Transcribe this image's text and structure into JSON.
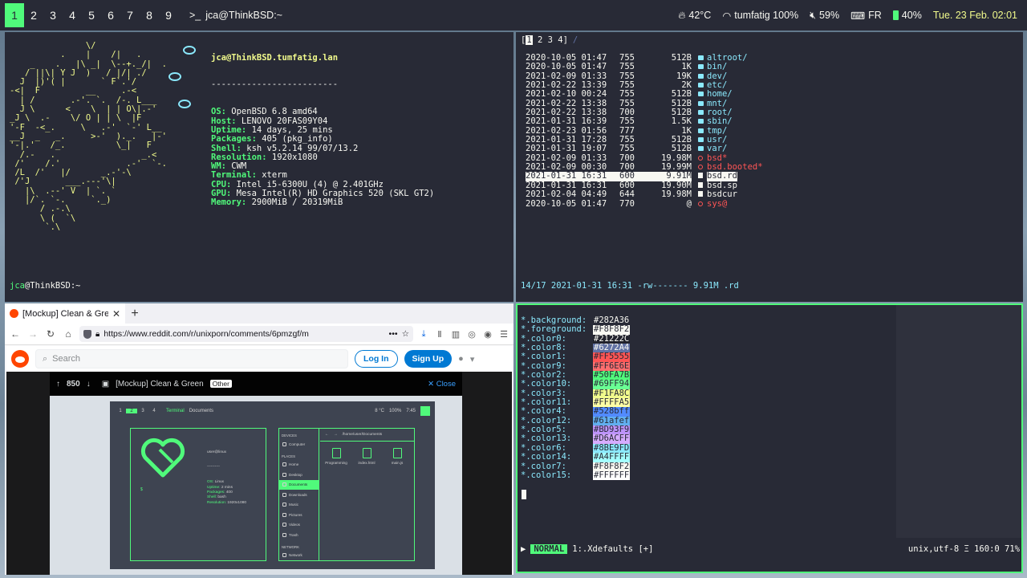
{
  "topbar": {
    "workspaces": [
      "1",
      "2",
      "3",
      "4",
      "5",
      "6",
      "7",
      "8",
      "9"
    ],
    "active_workspace": "1",
    "window_title": "jca@ThinkBSD:~",
    "temp": "42°C",
    "wifi": "tumfatig 100%",
    "volume": "59%",
    "keyboard": "FR",
    "battery": "40%",
    "datetime": "Tue. 23 Feb. 02:01"
  },
  "neofetch": {
    "ascii": [
      "               \\/",
      "          .    |    /|   .",
      "    _    .   |\\ _|  \\--+._/|  .",
      "   / ||\\| Y J  )   / |/| ./",
      "  J  |)'( |       ` F`.'/ ",
      "-<|  F         __     .-<",
      "  | /       .-'. `.  /-. L___",
      "  J \\      <    \\  | | O\\|.-'",
      "_J \\  .-    \\/ O | | \\  |F",
      "'-F  -<_.     \\   .-'  `-' L__",
      "__J  _   _.     >-'  )._.   |-'",
      "'-|.'   /_.          \\_|   F",
      "  /.-   .                 _.<",
      " /'    /.'             .-'  `-.",
      " /L  /'   |/      _.-'-\\",
      " /'J       ___.---'\\|",
      "   |\\  .--' V  | `. `",
      "   |/`. `-.     `._)",
      "      / .-.\\",
      "      \\ (  `\\",
      "       `.\\"
    ],
    "header_user": "jca",
    "header_host": "@ThinkBSD.tumfatig.lan",
    "separator": "-------------------------",
    "rows": [
      {
        "k": "OS:",
        "v": " OpenBSD 6.8 amd64"
      },
      {
        "k": "Host:",
        "v": " LENOVO 20FAS09Y04"
      },
      {
        "k": "Uptime:",
        "v": " 14 days, 25 mins"
      },
      {
        "k": "Packages:",
        "v": " 405 (pkg_info)"
      },
      {
        "k": "Shell:",
        "v": " ksh v5.2.14 99/07/13.2"
      },
      {
        "k": "Resolution:",
        "v": " 1920x1080"
      },
      {
        "k": "WM:",
        "v": " CWM"
      },
      {
        "k": "Terminal:",
        "v": " xterm"
      },
      {
        "k": "CPU:",
        "v": " Intel i5-6300U (4) @ 2.401GHz"
      },
      {
        "k": "GPU:",
        "v": " Mesa Intel(R) HD Graphics 520 (SKL GT2)"
      },
      {
        "k": "Memory:",
        "v": " 2900MiB / 20319MiB"
      }
    ],
    "prompt_user": "jca",
    "prompt_host": "@ThinkBSD:~",
    "prompt_sign": "# "
  },
  "lf": {
    "tab_active": "1",
    "tabs_rest": " 2 3 4]",
    "tab_open": "[",
    "path": "/",
    "rows": [
      {
        "d": "2020-10-05 01:47",
        "p": "755",
        "s": "512B",
        "n": "altroot/",
        "t": "dir"
      },
      {
        "d": "2020-10-05 01:47",
        "p": "755",
        "s": "1K",
        "n": "bin/",
        "t": "dir"
      },
      {
        "d": "2021-02-09 01:33",
        "p": "755",
        "s": "19K",
        "n": "dev/",
        "t": "dir"
      },
      {
        "d": "2021-02-22 13:39",
        "p": "755",
        "s": "2K",
        "n": "etc/",
        "t": "dir"
      },
      {
        "d": "2021-02-10 00:24",
        "p": "755",
        "s": "512B",
        "n": "home/",
        "t": "dir"
      },
      {
        "d": "2021-02-22 13:38",
        "p": "755",
        "s": "512B",
        "n": "mnt/",
        "t": "dir"
      },
      {
        "d": "2021-02-22 13:38",
        "p": "700",
        "s": "512B",
        "n": "root/",
        "t": "dir"
      },
      {
        "d": "2021-01-31 16:39",
        "p": "755",
        "s": "1.5K",
        "n": "sbin/",
        "t": "dir"
      },
      {
        "d": "2021-02-23 01:56",
        "p": "777",
        "s": "1K",
        "n": "tmp/",
        "t": "dir"
      },
      {
        "d": "2021-01-31 17:28",
        "p": "755",
        "s": "512B",
        "n": "usr/",
        "t": "dir"
      },
      {
        "d": "2021-01-31 19:07",
        "p": "755",
        "s": "512B",
        "n": "var/",
        "t": "dir"
      },
      {
        "d": "2021-02-09 01:33",
        "p": "700",
        "s": "19.98M",
        "n": "bsd*",
        "t": "warn"
      },
      {
        "d": "2021-02-09 00:30",
        "p": "700",
        "s": "19.99M",
        "n": "bsd.booted*",
        "t": "warn"
      },
      {
        "d": "2021-01-31 16:31",
        "p": "600",
        "s": "9.91M",
        "n": "bsd.rd",
        "t": "sel"
      },
      {
        "d": "2021-01-31 16:31",
        "p": "600",
        "s": "19.90M",
        "n": "bsd.sp",
        "t": "file"
      },
      {
        "d": "2021-02-04 04:49",
        "p": "644",
        "s": "19.98M",
        "n": "bsdcur",
        "t": "file"
      },
      {
        "d": "2020-10-05 01:47",
        "p": "770",
        "s": "@",
        "n": "sys@",
        "t": "warn"
      }
    ],
    "status": "14/17 2021-01-31 16:31 -rw------- 9.91M .rd"
  },
  "browser": {
    "tab_title": "[Mockup] Clean & Green",
    "url": "https://www.reddit.com/r/unixporn/comments/6pmzgf/m",
    "search_placeholder": "Search",
    "login": "Log In",
    "signup": "Sign Up",
    "post": {
      "score": "850",
      "title": "[Mockup] Clean & Green",
      "flair": "Other",
      "close": "Close"
    },
    "mockup": {
      "workspaces": [
        "1",
        "2",
        "3",
        "4"
      ],
      "active": "2",
      "term_label": "Terminal",
      "docs_label": "Documents",
      "status_temp": "8 °C",
      "status_batt": "100%",
      "status_time": "7:45",
      "info_title": "user@linux",
      "info_sep": "----------",
      "info_rows": [
        {
          "k": "OS:",
          "v": " Linux"
        },
        {
          "k": "Uptime:",
          "v": " 2 mins"
        },
        {
          "k": "Packages:",
          "v": " 400"
        },
        {
          "k": "Shell:",
          "v": " bash"
        },
        {
          "k": "Resolution:",
          "v": " 1920x1080"
        }
      ],
      "prompt": "$ ",
      "devices_header": "DEVICES",
      "devices": [
        "Computer"
      ],
      "places_header": "PLACES",
      "places": [
        "Home",
        "Desktop",
        "Documents",
        "Downloads",
        "Music",
        "Pictures",
        "Videos",
        "Trash"
      ],
      "places_selected": "Documents",
      "network_header": "NETWORK",
      "network": [
        "Network"
      ],
      "path": "/home/user/Documents",
      "files": [
        "Programming",
        "index.html",
        "main.js"
      ]
    }
  },
  "vim": {
    "lines": [
      {
        "k": "*.background:",
        "v": "#282A36",
        "bg": "#282a36",
        "fg": "#f8f8f2"
      },
      {
        "k": "*.foreground:",
        "v": "#F8F8F2",
        "bg": "#f8f8f2",
        "fg": "#282a36"
      },
      {
        "k": "*.color0:",
        "v": "#21222C",
        "bg": "#21222c",
        "fg": "#f8f8f2"
      },
      {
        "k": "*.color8:",
        "v": "#6272A4",
        "bg": "#6272a4",
        "fg": "#f8f8f2"
      },
      {
        "k": "*.color1:",
        "v": "#FF5555",
        "bg": "#ff5555",
        "fg": "#282a36"
      },
      {
        "k": "*.color9:",
        "v": "#FF6E6E",
        "bg": "#ff6e6e",
        "fg": "#282a36"
      },
      {
        "k": "*.color2:",
        "v": "#50FA7B",
        "bg": "#50fa7b",
        "fg": "#282a36"
      },
      {
        "k": "*.color10:",
        "v": "#69FF94",
        "bg": "#69ff94",
        "fg": "#282a36"
      },
      {
        "k": "*.color3:",
        "v": "#F1FA8C",
        "bg": "#f1fa8c",
        "fg": "#282a36"
      },
      {
        "k": "*.color11:",
        "v": "#FFFFA5",
        "bg": "#ffffa5",
        "fg": "#282a36"
      },
      {
        "k": "*.color4:",
        "v": "#528bff",
        "bg": "#528bff",
        "fg": "#282a36"
      },
      {
        "k": "*.color12:",
        "v": "#61afef",
        "bg": "#61afef",
        "fg": "#282a36"
      },
      {
        "k": "*.color5:",
        "v": "#BD93F9",
        "bg": "#bd93f9",
        "fg": "#282a36"
      },
      {
        "k": "*.color13:",
        "v": "#D6ACFF",
        "bg": "#d6acff",
        "fg": "#282a36"
      },
      {
        "k": "*.color6:",
        "v": "#8BE9FD",
        "bg": "#8be9fd",
        "fg": "#282a36"
      },
      {
        "k": "*.color14:",
        "v": "#A4FFFF",
        "bg": "#a4ffff",
        "fg": "#282a36"
      },
      {
        "k": "*.color7:",
        "v": "#F8F8F2",
        "bg": "#f8f8f2",
        "fg": "#282a36"
      },
      {
        "k": "*.color15:",
        "v": "#FFFFFF",
        "bg": "#ffffff",
        "fg": "#282a36"
      }
    ],
    "mode": "NORMAL",
    "filename": "1:.Xdefaults [+]",
    "right_status": "unix,utf-8 Ξ 160:0 71%"
  },
  "colors": {
    "accent": "#50fa7b",
    "background": "#282a36",
    "foreground": "#f8f8f2",
    "cyan": "#8be9fd",
    "yellow": "#f1fa8c",
    "red": "#ff5555"
  }
}
